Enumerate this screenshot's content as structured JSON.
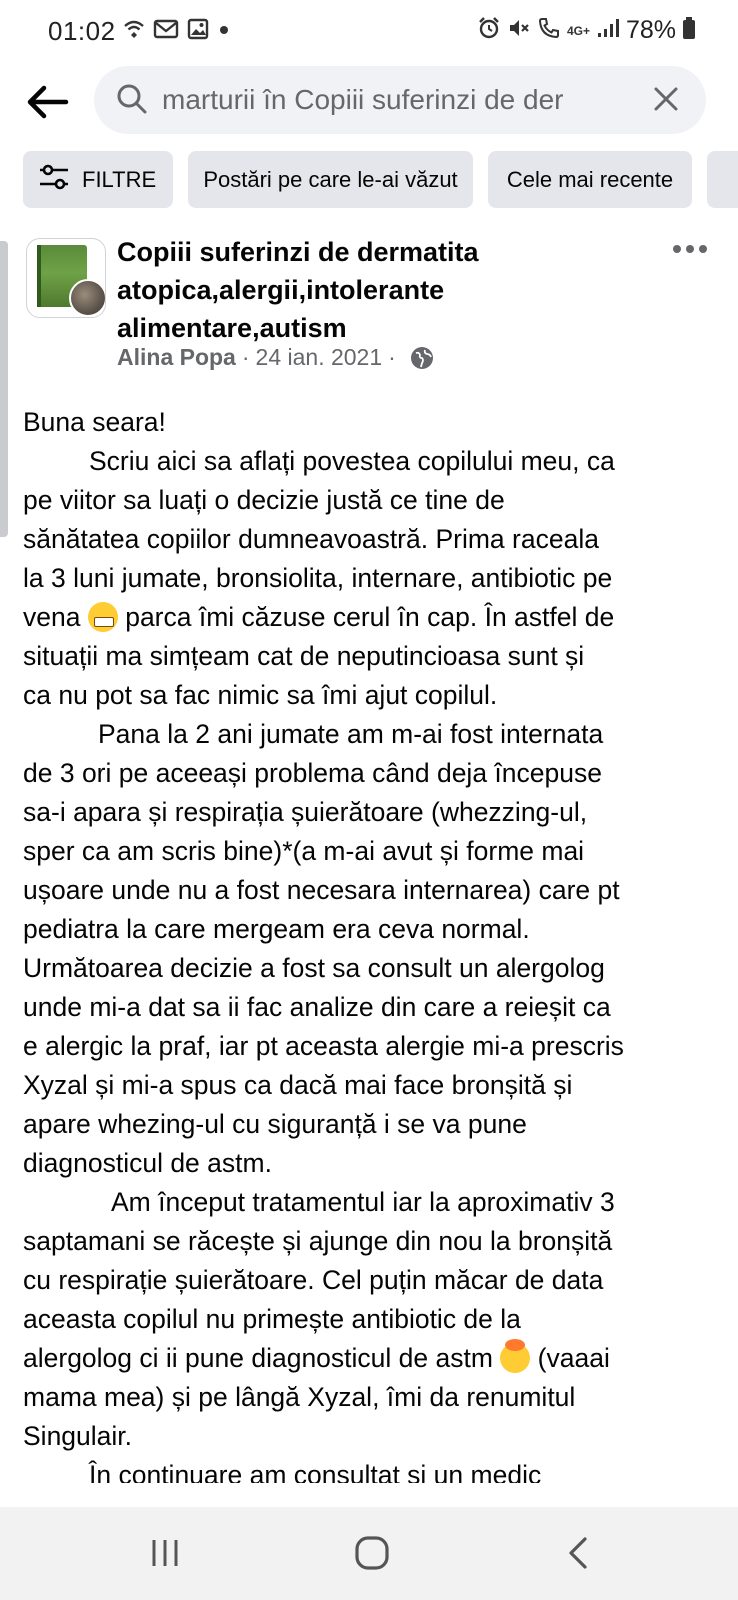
{
  "status_bar": {
    "time": "01:02",
    "battery": "78%",
    "left_icons": [
      "wifi-calling-icon",
      "gmail-icon",
      "gallery-icon",
      "dot-icon"
    ],
    "right_icons": [
      "alarm-icon",
      "mute-icon",
      "call-icon",
      "4g-icon",
      "signal-icon",
      "battery-icon"
    ],
    "network_label": "4G+"
  },
  "search": {
    "query": "marturii în Copiii suferinzi de der"
  },
  "chips": [
    {
      "label": "FILTRE",
      "icon": "filter-sliders-icon"
    },
    {
      "label": "Postări pe care le-ai văzut"
    },
    {
      "label": "Cele mai recente"
    }
  ],
  "post": {
    "group_name": "Copiii suferinzi de dermatita atopica,alergii,intolerante alimentare,autism",
    "author": "Alina Popa",
    "separator": "·",
    "date": "24 ian. 2021",
    "privacy_icon": "globe-icon",
    "lines": [
      {
        "text": "Buna seara!",
        "indent": 0
      },
      {
        "text": "Scriu aici sa aflați povestea copilului meu, ca",
        "indent": 1
      },
      {
        "text": "pe viitor sa luați o decizie justă ce tine de",
        "indent": 0
      },
      {
        "text": "sănătatea copiilor dumneavoastră. Prima raceala",
        "indent": 0
      },
      {
        "text": "la 3 luni jumate, bronsiolita, internare, antibiotic pe",
        "indent": 0
      },
      {
        "text": "vena",
        "emoji": "grimacing-face-emoji",
        "after": " parca îmi căzuse cerul în cap. În astfel de",
        "indent": 0
      },
      {
        "text": "situații ma simțeam cat de neputincioasa sunt și",
        "indent": 0
      },
      {
        "text": "ca nu pot sa fac nimic sa îmi ajut copilul.",
        "indent": 0
      },
      {
        "text": "Pana la 2 ani jumate am m-ai fost internata",
        "indent": 2
      },
      {
        "text": "de 3 ori pe aceeași problema când deja începuse",
        "indent": 0
      },
      {
        "text": "sa-i apara și respirația șuierătoare (whezzing-ul,",
        "indent": 0
      },
      {
        "text": "sper ca am scris bine)*(a m-ai avut și forme mai",
        "indent": 0
      },
      {
        "text": "ușoare unde nu a fost necesara internarea) care pt",
        "indent": 0
      },
      {
        "text": "pediatra la care mergeam era ceva normal.",
        "indent": 0
      },
      {
        "text": "Următoarea decizie a fost sa consult un alergolog",
        "indent": 0
      },
      {
        "text": "unde mi-a dat sa ii fac analize din care a reieșit ca",
        "indent": 0
      },
      {
        "text": "e alergic la praf, iar pt aceasta alergie mi-a prescris",
        "indent": 0
      },
      {
        "text": "Xyzal și mi-a spus ca dacă mai face bronșită și",
        "indent": 0
      },
      {
        "text": "apare whezing-ul cu siguranță i se va pune",
        "indent": 0
      },
      {
        "text": "diagnosticul de astm.",
        "indent": 0
      },
      {
        "text": "Am început tratamentul iar la aproximativ 3",
        "indent": 3
      },
      {
        "text": "saptamani se răcește și ajunge din nou la bronșită",
        "indent": 0
      },
      {
        "text": "cu respirație șuierătoare. Cel puțin măcar de data",
        "indent": 0
      },
      {
        "text": "aceasta copilul nu primește antibiotic de la",
        "indent": 0
      },
      {
        "text": "alergolog ci ii pune diagnosticul de astm",
        "emoji": "exploding-head-emoji",
        "after": " (vaaai",
        "indent": 0
      },
      {
        "text": "mama mea) și pe lângă Xyzal, îmi da renumitul",
        "indent": 0
      },
      {
        "text": "Singulair.",
        "indent": 0
      },
      {
        "text": "În continuare am consultat și un medic",
        "indent": 4
      }
    ]
  },
  "nav_bar": {
    "buttons": [
      "recents-icon",
      "home-icon",
      "back-chevron-icon"
    ]
  },
  "colors": {
    "chip_bg": "#e4e6eb",
    "search_bg": "#f0f2f5",
    "secondary_text": "#65676b",
    "nav_bg": "#f2f2f2"
  }
}
